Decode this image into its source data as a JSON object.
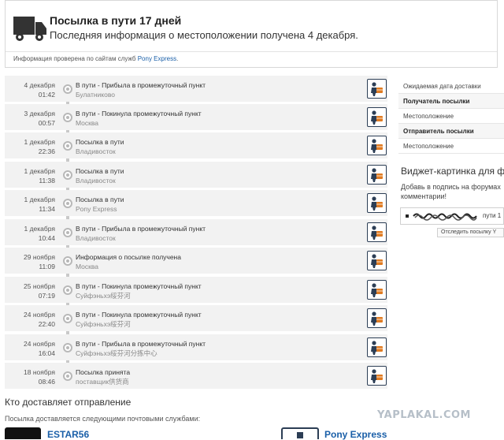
{
  "header": {
    "title": "Посылка в пути 17 дней",
    "subtitle": "Последняя информация о местоположении получена 4 декабря.",
    "checked_prefix": "Информация проверена по сайтам служб",
    "checked_service": "Pony Express"
  },
  "events": [
    {
      "date": "4 декабря",
      "time": "01:42",
      "status": "В пути - Прибыла в промежуточный пункт",
      "place": "Булатниково"
    },
    {
      "date": "3 декабря",
      "time": "00:57",
      "status": "В пути - Покинула промежуточный пункт",
      "place": "Москва"
    },
    {
      "date": "1 декабря",
      "time": "22:36",
      "status": "Посылка в пути",
      "place": "Владивосток"
    },
    {
      "date": "1 декабря",
      "time": "11:38",
      "status": "Посылка в пути",
      "place": "Владивосток"
    },
    {
      "date": "1 декабря",
      "time": "11:34",
      "status": "Посылка в пути",
      "place": "Pony Express"
    },
    {
      "date": "1 декабря",
      "time": "10:44",
      "status": "В пути - Прибыла в промежуточный пункт",
      "place": "Владивосток"
    },
    {
      "date": "29 ноября",
      "time": "11:09",
      "status": "Информация о посылке получена",
      "place": "Москва"
    },
    {
      "date": "25 ноября",
      "time": "07:19",
      "status": "В пути - Покинула промежуточный пункт",
      "place": "Суйфэньхэ绥芬河"
    },
    {
      "date": "24 ноября",
      "time": "22:40",
      "status": "В пути - Покинула промежуточный пункт",
      "place": "Суйфэньхэ绥芬河"
    },
    {
      "date": "24 ноября",
      "time": "16:04",
      "status": "В пути - Прибыла в промежуточный пункт",
      "place": "Суйфэньхэ绥芬河分拣中心"
    },
    {
      "date": "18 ноября",
      "time": "08:46",
      "status": "Посылка принята",
      "place": "поставщик供货商"
    }
  ],
  "right_panel": {
    "rows": [
      {
        "label": "Ожидаемая дата доставки",
        "bold": false
      },
      {
        "label": "Получатель посылки",
        "bold": true
      },
      {
        "label": "Местоположение",
        "bold": false
      },
      {
        "label": "Отправитель посылки",
        "bold": true
      },
      {
        "label": "Местоположение",
        "bold": false
      }
    ],
    "widget_title": "Виджет-картинка для ф",
    "widget_desc_1": "Добавь в подпись на форумах",
    "widget_desc_2": "комментарии!",
    "widget_text": "пути 1",
    "widget_tooltip": "Отследить посылку Y"
  },
  "carriers": {
    "title": "Кто доставляет отправление",
    "subtitle": "Посылка доставляется следующими почтовыми службами:",
    "services": [
      {
        "name": "ESTAR56"
      },
      {
        "name": "Pony Express"
      }
    ]
  },
  "watermark": "YAPLAKAL.COM",
  "colors": {
    "link": "#1a5fa8",
    "row_bg": "#f2f2f2",
    "icon_border": "#2c3e55",
    "icon_accent": "#e07b22"
  }
}
